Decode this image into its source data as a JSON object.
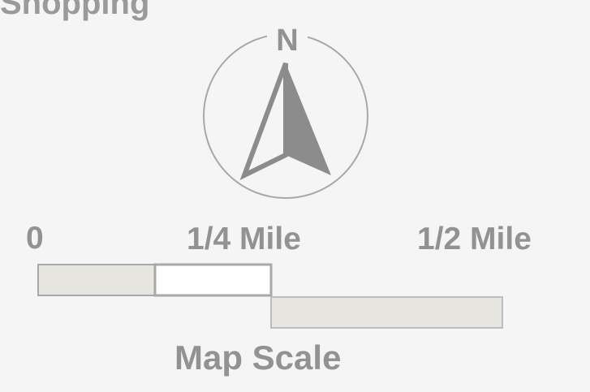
{
  "heading": "Shopping",
  "compass": {
    "north_label": "N",
    "icon": "north-arrow-icon"
  },
  "scale": {
    "labels": [
      "0",
      "1/4 Mile",
      "1/2 Mile"
    ],
    "title": "Map Scale"
  },
  "colors": {
    "text": "#929292",
    "stroke": "#a8a8a8",
    "arrow": "#8c8c8c",
    "bar_fill": "#e6e5df",
    "bar_empty": "#ffffff",
    "background": "#f5f5f5"
  }
}
